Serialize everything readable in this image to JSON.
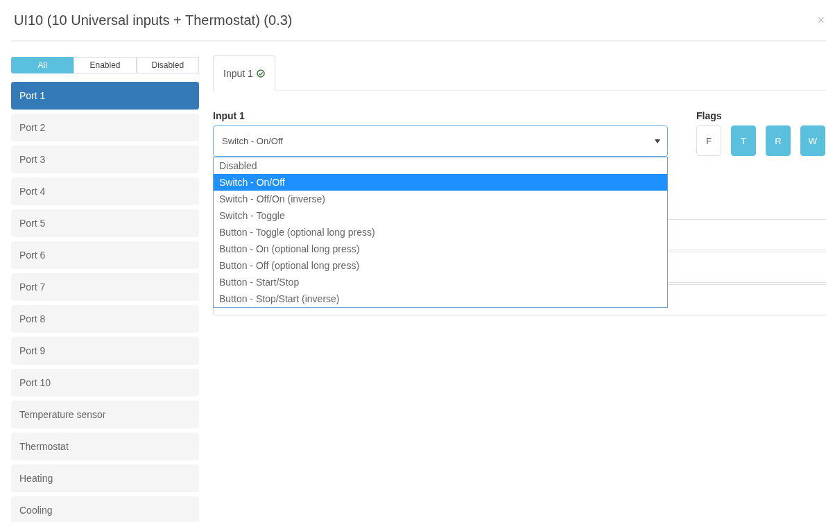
{
  "dialog": {
    "title": "UI10 (10 Universal inputs + Thermostat) (0.3)",
    "close": "×"
  },
  "filters": [
    {
      "label": "All",
      "selected": true
    },
    {
      "label": "Enabled",
      "selected": false
    },
    {
      "label": "Disabled",
      "selected": false
    }
  ],
  "ports": [
    {
      "label": "Port 1",
      "selected": true
    },
    {
      "label": "Port 2",
      "selected": false
    },
    {
      "label": "Port 3",
      "selected": false
    },
    {
      "label": "Port 4",
      "selected": false
    },
    {
      "label": "Port 5",
      "selected": false
    },
    {
      "label": "Port 6",
      "selected": false
    },
    {
      "label": "Port 7",
      "selected": false
    },
    {
      "label": "Port 8",
      "selected": false
    },
    {
      "label": "Port 9",
      "selected": false
    },
    {
      "label": "Port 10",
      "selected": false
    },
    {
      "label": "Temperature sensor",
      "selected": false
    },
    {
      "label": "Thermostat",
      "selected": false
    },
    {
      "label": "Heating",
      "selected": false
    },
    {
      "label": "Cooling",
      "selected": false
    }
  ],
  "tabs": [
    {
      "label": "Input 1",
      "selected": true,
      "valid": true
    }
  ],
  "input": {
    "label": "Input 1",
    "value": "Switch - On/Off",
    "expanded": true,
    "options": [
      {
        "label": "Disabled",
        "selected": false
      },
      {
        "label": "Switch - On/Off",
        "selected": true
      },
      {
        "label": "Switch - Off/On (inverse)",
        "selected": false
      },
      {
        "label": "Switch - Toggle",
        "selected": false
      },
      {
        "label": "Button - Toggle (optional long press)",
        "selected": false
      },
      {
        "label": "Button - On (optional long press)",
        "selected": false
      },
      {
        "label": "Button - Off (optional long press)",
        "selected": false
      },
      {
        "label": "Button - Start/Stop",
        "selected": false
      },
      {
        "label": "Button - Stop/Start (inverse)",
        "selected": false
      }
    ]
  },
  "flags": {
    "label": "Flags",
    "items": [
      {
        "label": "F",
        "on": false
      },
      {
        "label": "T",
        "on": true
      },
      {
        "label": "R",
        "on": true
      },
      {
        "label": "W",
        "on": true
      }
    ]
  }
}
